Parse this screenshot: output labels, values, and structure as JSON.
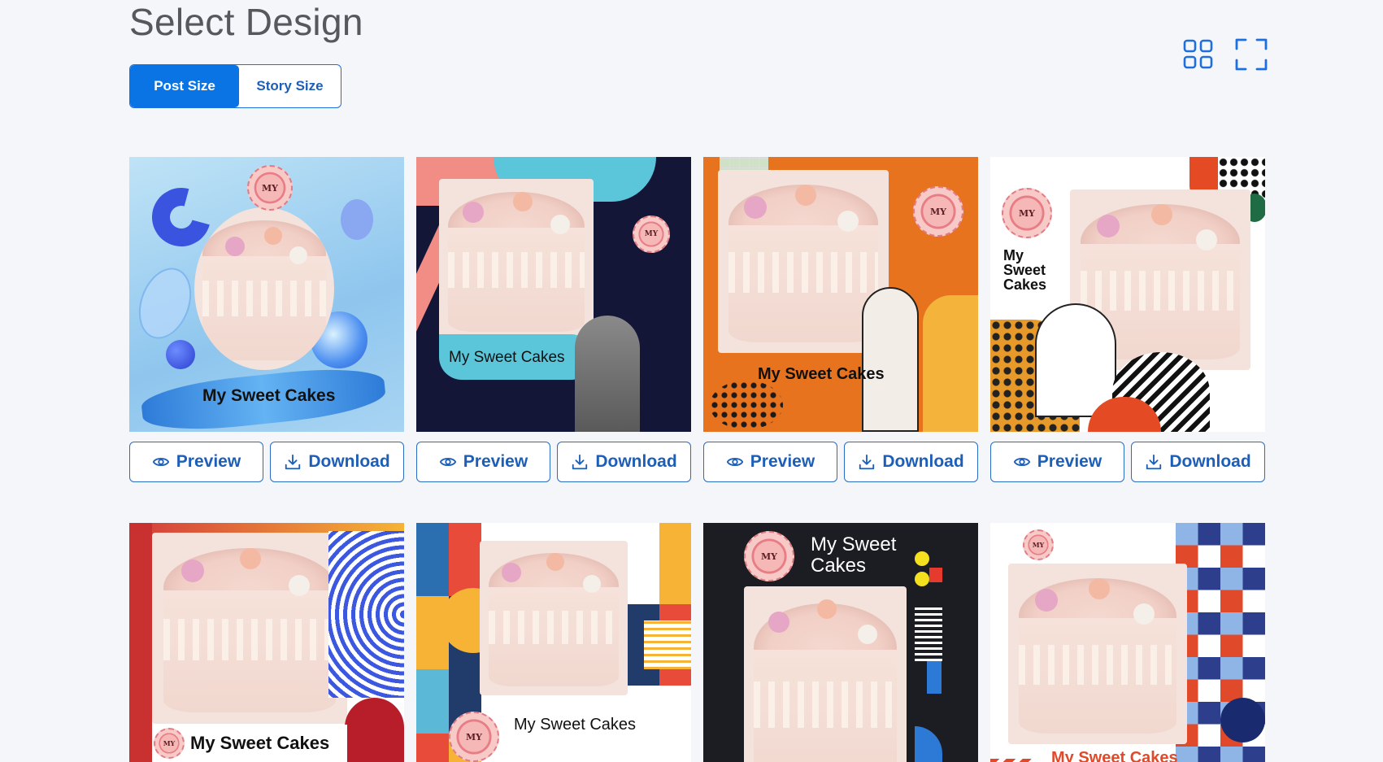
{
  "page": {
    "title": "Select Design"
  },
  "size_toggle": {
    "post_label": "Post Size",
    "story_label": "Story Size",
    "selected": "Post Size"
  },
  "view_icons": [
    "grid-view-icon",
    "fullscreen-icon"
  ],
  "actions": {
    "preview_label": "Preview",
    "download_label": "Download"
  },
  "brand": {
    "name": "My Sweet Cakes",
    "logo_text": "MY Sweet"
  },
  "designs": [
    {
      "caption": "My Sweet Cakes"
    },
    {
      "caption": "My Sweet Cakes"
    },
    {
      "caption": "My Sweet Cakes"
    },
    {
      "caption": "My Sweet Cakes",
      "caption_line1": "My",
      "caption_line2": "Sweet",
      "caption_line3": "Cakes"
    },
    {
      "caption": "My Sweet Cakes"
    },
    {
      "caption": "My Sweet Cakes"
    },
    {
      "caption": "My Sweet Cakes",
      "caption_line1": "My Sweet",
      "caption_line2": "Cakes"
    },
    {
      "caption": "My Sweet Cakes"
    }
  ],
  "colors": {
    "accent": "#0b74e5",
    "button_border": "#2a6bc4",
    "button_text": "#1d5fb8",
    "background": "#f4f6fa"
  }
}
